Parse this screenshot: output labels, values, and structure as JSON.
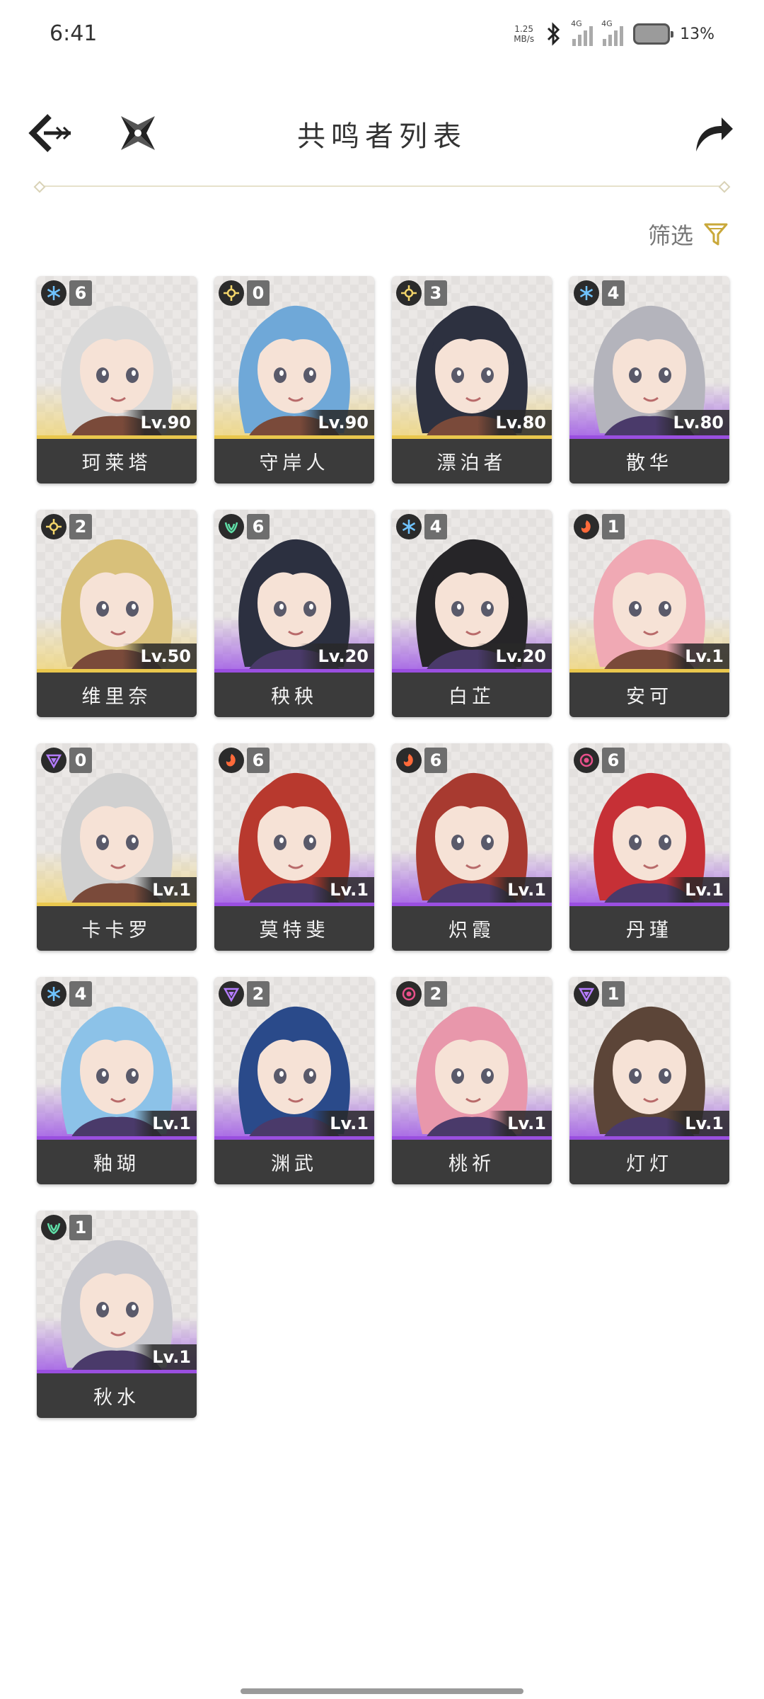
{
  "status_bar": {
    "time": "6:41",
    "net_speed_value": "1.25",
    "net_speed_unit": "MB/s",
    "sim1": "4G",
    "sim2": "4G",
    "battery_pct": "13%"
  },
  "header": {
    "title": "共鸣者列表",
    "filter_label": "筛选"
  },
  "colors": {
    "gold": "#e9c74d",
    "purple": "#9a4fe0",
    "accent_filter": "#c9a83a"
  },
  "cards": [
    {
      "name": "珂莱塔",
      "level": "Lv.90",
      "chain": "6",
      "element": "glacio",
      "rarity": "gold",
      "hair": "#d9d9d9"
    },
    {
      "name": "守岸人",
      "level": "Lv.90",
      "chain": "0",
      "element": "spectro",
      "rarity": "gold",
      "hair": "#6fa8d8"
    },
    {
      "name": "漂泊者",
      "level": "Lv.80",
      "chain": "3",
      "element": "spectro",
      "rarity": "gold",
      "hair": "#2d3140"
    },
    {
      "name": "散华",
      "level": "Lv.80",
      "chain": "4",
      "element": "glacio",
      "rarity": "purple",
      "hair": "#b4b4bc"
    },
    {
      "name": "维里奈",
      "level": "Lv.50",
      "chain": "2",
      "element": "spectro",
      "rarity": "gold",
      "hair": "#d8c07a"
    },
    {
      "name": "秧秧",
      "level": "Lv.20",
      "chain": "6",
      "element": "aero",
      "rarity": "purple",
      "hair": "#2c3040"
    },
    {
      "name": "白芷",
      "level": "Lv.20",
      "chain": "4",
      "element": "glacio",
      "rarity": "purple",
      "hair": "#262528"
    },
    {
      "name": "安可",
      "level": "Lv.1",
      "chain": "1",
      "element": "fusion",
      "rarity": "gold",
      "hair": "#f0a9b4"
    },
    {
      "name": "卡卡罗",
      "level": "Lv.1",
      "chain": "0",
      "element": "electro",
      "rarity": "gold",
      "hair": "#d0d0d0"
    },
    {
      "name": "莫特斐",
      "level": "Lv.1",
      "chain": "6",
      "element": "fusion",
      "rarity": "purple",
      "hair": "#b8392e"
    },
    {
      "name": "炽霞",
      "level": "Lv.1",
      "chain": "6",
      "element": "fusion",
      "rarity": "purple",
      "hair": "#a83a30"
    },
    {
      "name": "丹瑾",
      "level": "Lv.1",
      "chain": "6",
      "element": "havoc",
      "rarity": "purple",
      "hair": "#c63036"
    },
    {
      "name": "釉瑚",
      "level": "Lv.1",
      "chain": "4",
      "element": "glacio",
      "rarity": "purple",
      "hair": "#8cc2e8"
    },
    {
      "name": "渊武",
      "level": "Lv.1",
      "chain": "2",
      "element": "electro",
      "rarity": "purple",
      "hair": "#2a4a8a"
    },
    {
      "name": "桃祈",
      "level": "Lv.1",
      "chain": "2",
      "element": "havoc",
      "rarity": "purple",
      "hair": "#e897ab"
    },
    {
      "name": "灯灯",
      "level": "Lv.1",
      "chain": "1",
      "element": "electro",
      "rarity": "purple",
      "hair": "#5c4538"
    },
    {
      "name": "秋水",
      "level": "Lv.1",
      "chain": "1",
      "element": "aero",
      "rarity": "purple",
      "hair": "#c9c9cf"
    }
  ]
}
